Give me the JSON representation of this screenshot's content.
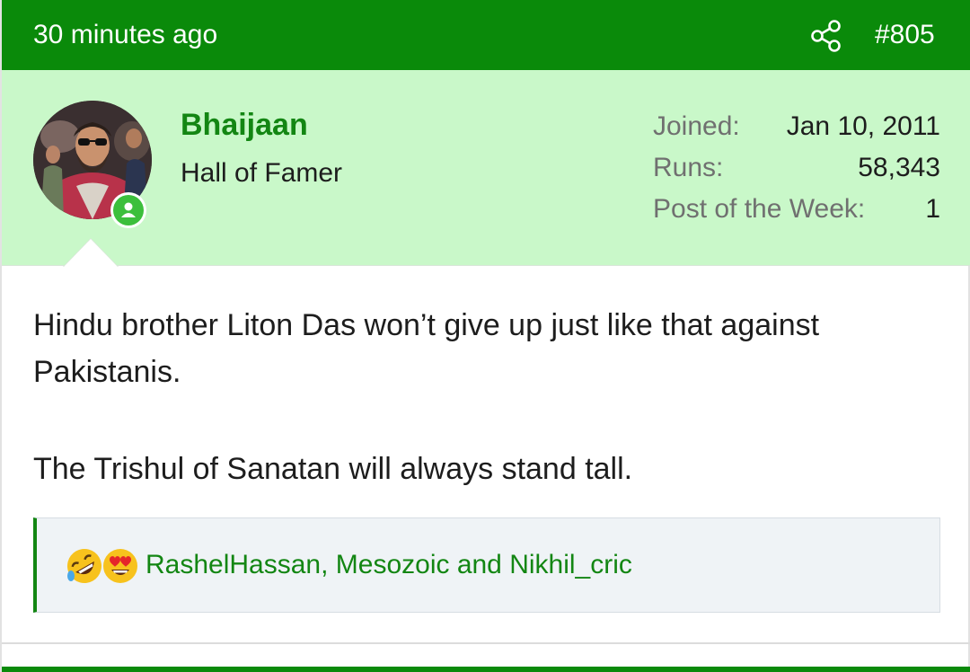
{
  "post": {
    "timestamp": "30 minutes ago",
    "post_number": "#805",
    "share_icon": "share-icon"
  },
  "user": {
    "name": "Bhaijaan",
    "title": "Hall of Famer",
    "online_icon": "online-user-icon",
    "stats": [
      {
        "label": "Joined:",
        "value": "Jan 10, 2011"
      },
      {
        "label": "Runs:",
        "value": "58,343"
      },
      {
        "label": "Post of the Week:",
        "value": "1"
      }
    ]
  },
  "message": {
    "paragraph1": "Hindu brother Liton Das won’t give up just like that against Pakistanis.",
    "paragraph2": "The Trishul of Sanatan will always stand tall."
  },
  "reactions": {
    "icons": [
      "rolling-laughing-emoji-icon",
      "heart-eyes-emoji-icon"
    ],
    "reactors_text": "RashelHassan, Mesozoic and Nikhil_cric"
  },
  "colors": {
    "header": "#0a8a0a",
    "user_panel": "#c9f8c9",
    "accent_text": "#138613",
    "reaction_bg": "#eff3f6"
  }
}
